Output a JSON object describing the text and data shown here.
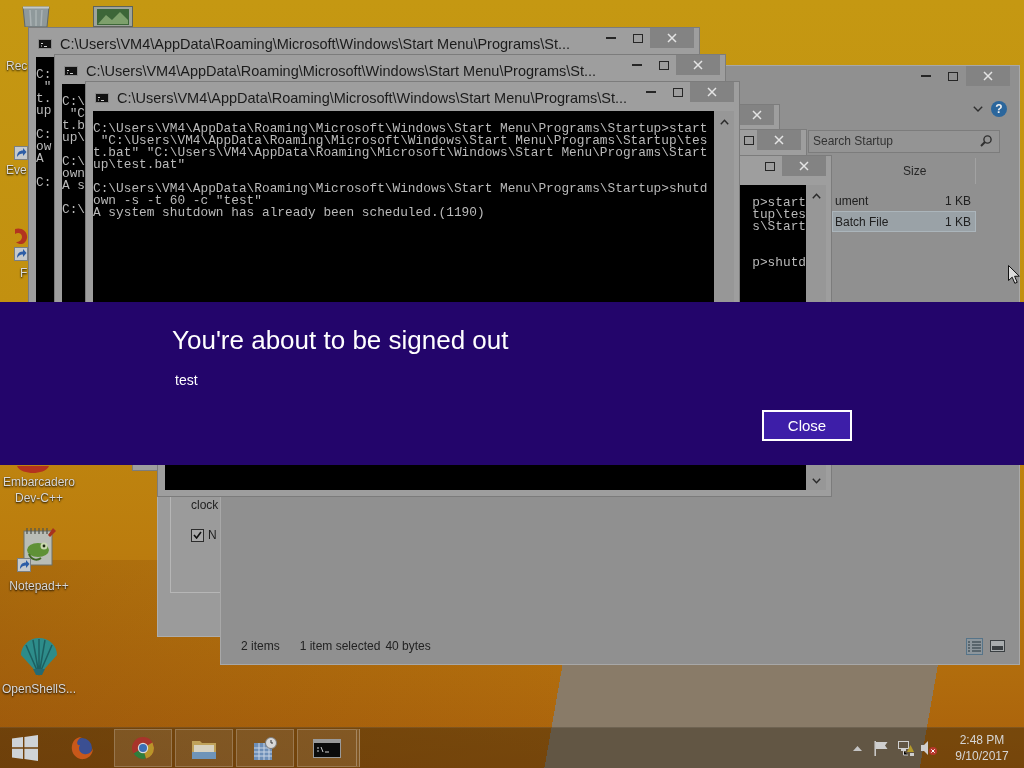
{
  "desktop_icons": [
    {
      "kind": "bin",
      "label": "Rec"
    },
    {
      "kind": "picture"
    },
    {
      "kind": "shortcut",
      "label": "Eve"
    },
    {
      "kind": "swirl-shortcut",
      "label": "F"
    },
    {
      "kind": "app",
      "label": "Embarcadero Dev-C++"
    },
    {
      "kind": "notepad",
      "label": "Notepad++"
    },
    {
      "kind": "shell",
      "label": "OpenShellS..."
    }
  ],
  "consoles": [
    {
      "title": "C:\\Users\\VM4\\AppData\\Roaming\\Microsoft\\Windows\\Start Menu\\Programs\\St...",
      "buttons": [
        {
          "kind": "minimize"
        },
        {
          "kind": "maximize"
        },
        {
          "kind": "close"
        }
      ],
      "output": "C:\n \"\nt.\nup\n\nC:\now\nA\n\nC:"
    },
    {
      "title": "C:\\Users\\VM4\\AppData\\Roaming\\Microsoft\\Windows\\Start Menu\\Programs\\St...",
      "buttons": [
        {
          "kind": "minimize"
        },
        {
          "kind": "maximize"
        },
        {
          "kind": "close"
        }
      ],
      "output": "C:\\\n \"C\nt.b\nup\\\n\nC:\\\nown\nA s\n\nC:\\"
    },
    {
      "title": "C:\\Users\\VM4\\AppData\\Roaming\\Microsoft\\Windows\\Start Menu\\Programs\\St...",
      "buttons": [
        {
          "kind": "minimize"
        },
        {
          "kind": "maximize"
        },
        {
          "kind": "close"
        }
      ],
      "output": "C:\\Users\\VM4\\AppData\\Roaming\\Microsoft\\Windows\\Start Menu\\Programs\\Startup>start\n \"C:\\Users\\VM4\\AppData\\Roaming\\Microsoft\\Windows\\Start Menu\\Programs\\Startup\\tes\nt.bat\" \"C:\\Users\\VM4\\AppData\\Roaming\\Microsoft\\Windows\\Start Menu\\Programs\\Start\nup\\test.bat\"\n\nC:\\Users\\VM4\\AppData\\Roaming\\Microsoft\\Windows\\Start Menu\\Programs\\Startup>shutd\nown -s -t 60 -c \"test\"\nA system shutdown has already been scheduled.(1190)"
    },
    {
      "buttons": [
        {
          "kind": "close"
        }
      ]
    },
    {
      "buttons": [
        {
          "kind": "maximize"
        },
        {
          "kind": "close"
        }
      ]
    },
    {
      "buttons": [
        {
          "kind": "maximize"
        },
        {
          "kind": "close"
        }
      ],
      "output": "p>start\ntup\\tes\ns\\Start\n\n\np>shutd"
    }
  ],
  "explorer": {
    "help": "?",
    "search": {
      "placeholder": "Search Startup"
    },
    "columns": [
      {
        "label": "Size"
      }
    ],
    "rows": [
      {
        "type": "ument",
        "size": "1 KB",
        "selected": false
      },
      {
        "type": "Batch File",
        "size": "1 KB",
        "selected": true
      }
    ],
    "status_bar": {
      "items": "2 items",
      "selection": "1 item selected",
      "size": "40 bytes"
    },
    "views": [
      {
        "kind": "details",
        "selected": true
      },
      {
        "kind": "thumbnails",
        "selected": false
      }
    ]
  },
  "dialog": {
    "text": "clock",
    "checkbox": {
      "label": "N",
      "checked": true
    }
  },
  "notification": {
    "title": "You're about to be signed out",
    "message": "test",
    "button": "Close"
  },
  "taskbar": {
    "apps": [
      {
        "kind": "swirl",
        "running": false,
        "stacked": false
      },
      {
        "kind": "ring",
        "running": true,
        "stacked": false
      },
      {
        "kind": "folder",
        "running": true,
        "stacked": false
      },
      {
        "kind": "calendar",
        "running": true,
        "stacked": false
      },
      {
        "kind": "console",
        "running": true,
        "stacked": true
      }
    ],
    "volume_muted": true,
    "time": "2:48 PM",
    "date": "9/10/2017"
  }
}
